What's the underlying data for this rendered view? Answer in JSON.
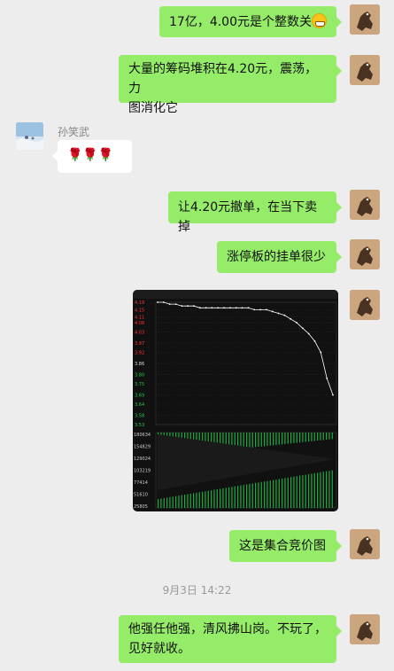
{
  "messages": {
    "m1": "17亿，4.00元是个整数关",
    "m2_line1": "大量的筹码堆积在4.20元，震荡，力",
    "m2_line2": "图消化它",
    "m3_sender": "孙笑武",
    "m3_content": "🌹🌹🌹",
    "m4": "让4.20元撤单，在当下卖掉",
    "m5": "涨停板的挂单很少",
    "m7": "这是集合竞价图",
    "time_separator": "9月3日 14:22",
    "m8_line1": "他强任他强，清风拂山岗。不玩了，",
    "m8_line2": "见好就收。"
  },
  "chart_data": {
    "type": "line",
    "title": "",
    "price_ticks": [
      "4.19",
      "4.15",
      "4.11",
      "4.08",
      "4.03",
      "3.97",
      "3.92",
      "3.86",
      "3.80",
      "3.75",
      "3.69",
      "3.64",
      "3.58",
      "3.53"
    ],
    "volume_ticks": [
      "180634",
      "154829",
      "129024",
      "103219",
      "77414",
      "51610",
      "25805"
    ],
    "price_series": [
      4.19,
      4.19,
      4.18,
      4.18,
      4.17,
      4.17,
      4.17,
      4.16,
      4.16,
      4.16,
      4.16,
      4.16,
      4.16,
      4.16,
      4.16,
      4.16,
      4.15,
      4.15,
      4.15,
      4.14,
      4.13,
      4.12,
      4.1,
      4.08,
      4.05,
      4.02,
      3.98,
      3.92,
      3.78,
      3.69
    ],
    "colors": {
      "up": "#ff3333",
      "down": "#22cc44",
      "line": "#ffffff",
      "grid": "#3a3a3a",
      "volume": "#22aa44"
    }
  }
}
